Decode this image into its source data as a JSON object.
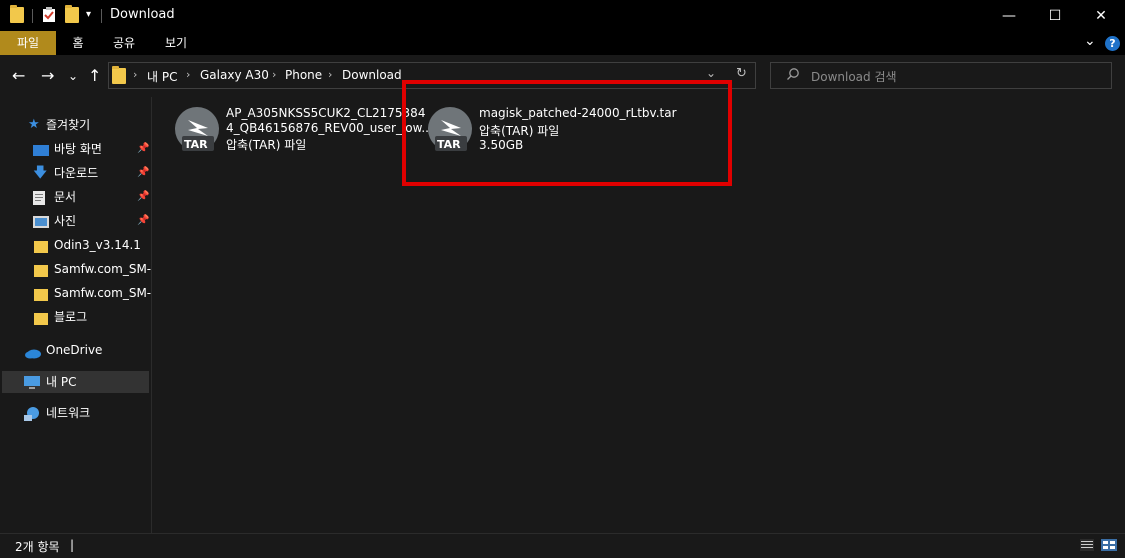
{
  "window": {
    "title": "Download",
    "minimize_glyph": "—",
    "maximize_glyph": "☐",
    "close_glyph": "✕"
  },
  "ribbon": {
    "tabs": [
      "파일",
      "홈",
      "공유",
      "보기"
    ],
    "expand_glyph": "⌄",
    "help_glyph": "?"
  },
  "nav": {
    "back_glyph": "←",
    "forward_glyph": "→",
    "recent_glyph": "⌄",
    "up_glyph": "↑",
    "breadcrumb": [
      "내 PC",
      "Galaxy A30",
      "Phone",
      "Download"
    ],
    "breadcrumb_sep": "›",
    "dropdown_glyph": "⌄",
    "refresh_glyph": "↻"
  },
  "search": {
    "placeholder": "Download 검색"
  },
  "sidebar": {
    "quick_access": "즐겨찾기",
    "pinned": [
      "바탕 화면",
      "다운로드",
      "문서",
      "사진"
    ],
    "folders": [
      "Odin3_v3.14.1",
      "Samfw.com_SM-A",
      "Samfw.com_SM-N",
      "블로그"
    ],
    "onedrive": "OneDrive",
    "mypc": "내 PC",
    "network": "네트워크"
  },
  "files": [
    {
      "name_line1": "AP_A305NKSS5CUK2_CL2175384",
      "name_line2": "4_QB46156876_REV00_user_low...",
      "type": "압축(TAR) 파일",
      "size": "",
      "icon_label": "TAR"
    },
    {
      "name_line1": "magisk_patched-24000_rLtbv.tar",
      "name_line2": "",
      "type": "압축(TAR) 파일",
      "size": "3.50GB",
      "icon_label": "TAR"
    }
  ],
  "status": {
    "item_count": "2개 항목",
    "separator": "|"
  },
  "colors": {
    "background": "#191919",
    "titlebar": "#000000",
    "file_tab": "#b18a1c",
    "highlight": "#e00000",
    "folder": "#f2c84b"
  }
}
